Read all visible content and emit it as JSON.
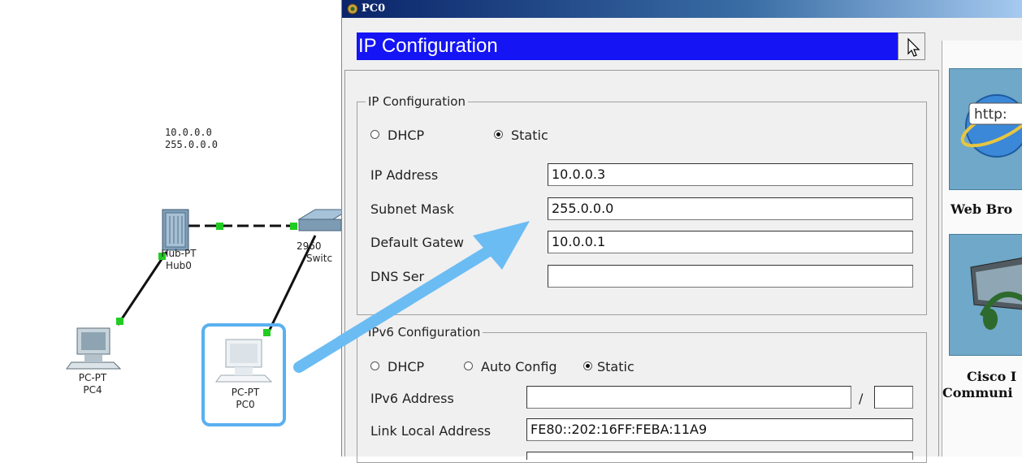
{
  "topology": {
    "network_address": "10.0.0.0",
    "network_mask": "255.0.0.0",
    "hub": {
      "type": "Hub-PT",
      "name": "Hub0"
    },
    "switch": {
      "type": "2960",
      "name": "Switc"
    },
    "pc4": {
      "type": "PC-PT",
      "name": "PC4"
    },
    "pc0": {
      "type": "PC-PT",
      "name": "PC0"
    }
  },
  "dialog": {
    "title": "PC0",
    "header": "IP Configuration",
    "ipv4": {
      "legend": "IP Configuration",
      "dhcp_label": "DHCP",
      "static_label": "Static",
      "mode": "static",
      "ip_label": "IP Address",
      "ip_value": "10.0.0.3",
      "mask_label": "Subnet Mask",
      "mask_value": "255.0.0.0",
      "gateway_label": "Default Gatew",
      "gateway_value": "10.0.0.1",
      "dns_label": "DNS Ser",
      "dns_value": ""
    },
    "ipv6": {
      "legend": "IPv6 Configuration",
      "dhcp_label": "DHCP",
      "auto_label": "Auto Config",
      "static_label": "Static",
      "mode": "static",
      "address_label": "IPv6 Address",
      "address_value": "",
      "slash": "/",
      "prefix_value": "",
      "link_local_label": "Link Local Address",
      "link_local_value": "FE80::202:16FF:FEBA:11A9"
    }
  },
  "desktop_apps": {
    "web_browser_icon_text": "http:",
    "web_browser_label": "Web Bro",
    "cisco_label_line1": "Cisco I",
    "cisco_label_line2": "Communi"
  },
  "colors": {
    "header_blue": "#1414f5",
    "highlight_box": "#5ab0f0",
    "arrow": "#6bbcf3",
    "link_green": "#22cc22",
    "tile_blue": "#6fa8c8"
  },
  "icons": [
    "pc-icon",
    "hub-icon",
    "switch-icon",
    "cursor-icon",
    "browser-globe-icon",
    "headset-monitor-icon",
    "app-logo-icon"
  ]
}
